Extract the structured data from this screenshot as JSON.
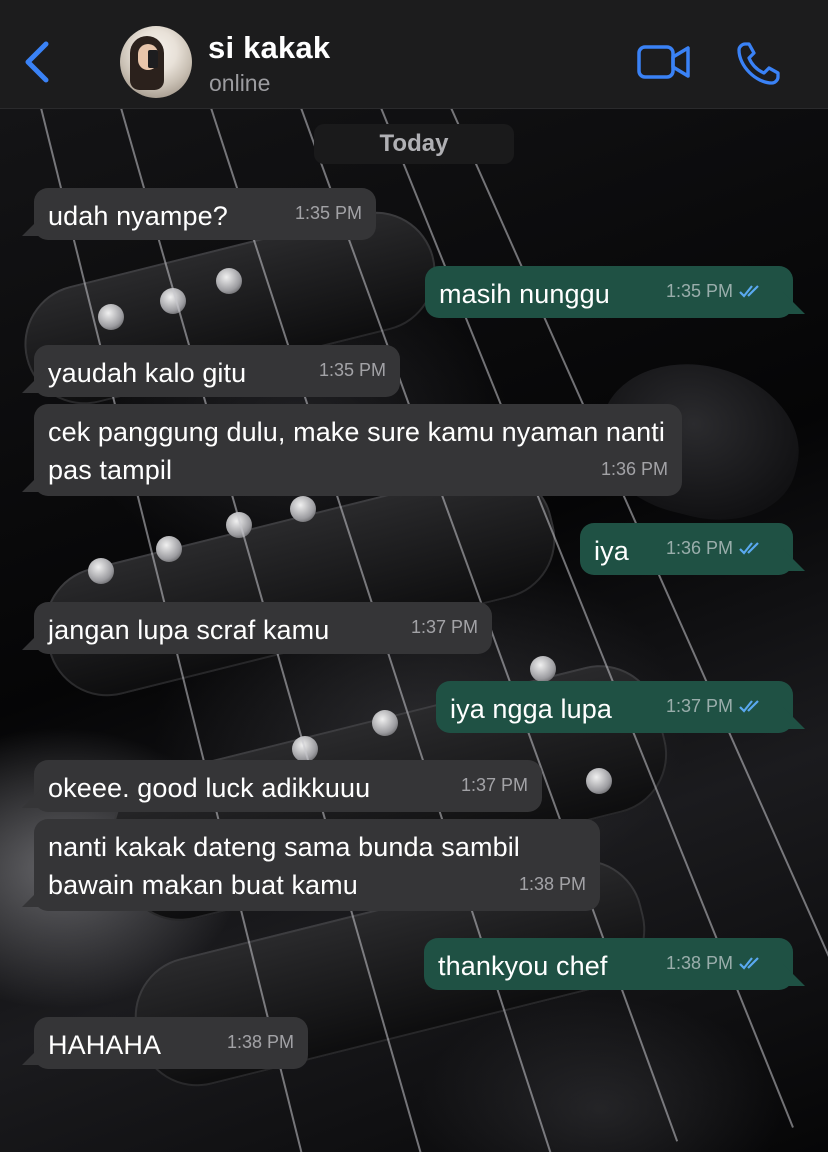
{
  "header": {
    "back_icon": "chevron-left-icon",
    "contact_name": "si kakak",
    "contact_status": "online",
    "video_icon": "video-camera-icon",
    "call_icon": "phone-icon",
    "accent_color": "#3a82f6"
  },
  "date_separator": "Today",
  "messages": [
    {
      "direction": "in",
      "text": "udah nyampe?",
      "time": "1:35 PM"
    },
    {
      "direction": "out",
      "text": "masih nunggu",
      "time": "1:35 PM",
      "read": true
    },
    {
      "direction": "in",
      "text": "yaudah kalo gitu",
      "time": "1:35 PM"
    },
    {
      "direction": "in",
      "text": "cek panggung dulu, make sure kamu nyaman nanti pas tampil",
      "time": "1:36 PM"
    },
    {
      "direction": "out",
      "text": "iya",
      "time": "1:36 PM",
      "read": true
    },
    {
      "direction": "in",
      "text": "jangan lupa scraf kamu",
      "time": "1:37 PM"
    },
    {
      "direction": "out",
      "text": "iya ngga lupa",
      "time": "1:37 PM",
      "read": true
    },
    {
      "direction": "in",
      "text": "okeee. good luck adikkuuu",
      "time": "1:37 PM"
    },
    {
      "direction": "in",
      "text": "nanti kakak dateng sama bunda sambil bawain makan buat kamu",
      "time": "1:38 PM"
    },
    {
      "direction": "out",
      "text": "thankyou chef",
      "time": "1:38 PM",
      "read": true
    },
    {
      "direction": "in",
      "text": "HAHAHA",
      "time": "1:38 PM"
    }
  ],
  "colors": {
    "incoming_bubble": "#353537",
    "outgoing_bubble": "#1f5144",
    "read_ticks": "#5aa9f0"
  }
}
